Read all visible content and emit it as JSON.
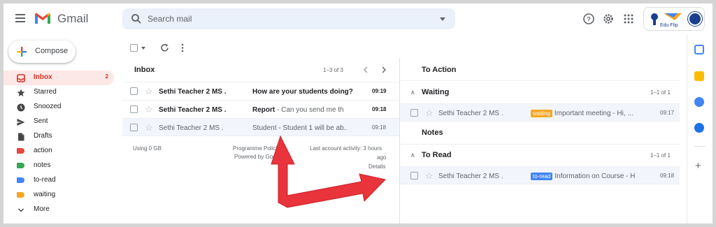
{
  "header": {
    "app_name": "Gmail",
    "search_placeholder": "Search mail",
    "edu_logo_text": "Edu Flip",
    "icons": [
      "menu-icon",
      "help-icon",
      "settings-icon",
      "apps-icon"
    ]
  },
  "compose_label": "Compose",
  "sidebar": {
    "items": [
      {
        "label": "Inbox",
        "count": "2",
        "icon": "inbox-icon",
        "active": true
      },
      {
        "label": "Starred",
        "icon": "star-icon"
      },
      {
        "label": "Snoozed",
        "icon": "clock-icon"
      },
      {
        "label": "Sent",
        "icon": "send-icon"
      },
      {
        "label": "Drafts",
        "icon": "draft-icon"
      },
      {
        "label": "action",
        "icon": "label-icon",
        "color": "#e8453c"
      },
      {
        "label": "notes",
        "icon": "label-icon",
        "color": "#34a853"
      },
      {
        "label": "to-read",
        "icon": "label-icon",
        "color": "#4285f4"
      },
      {
        "label": "waiting",
        "icon": "label-icon",
        "color": "#f6a623"
      },
      {
        "label": "More",
        "icon": "chevron-down-icon"
      }
    ]
  },
  "inbox": {
    "title": "Inbox",
    "pager": "1–3 of 3",
    "rows": [
      {
        "sender": "Sethi Teacher 2 MS .",
        "subject": "How are your students doing?",
        "snippet": "",
        "time": "09:19",
        "unread": true
      },
      {
        "sender": "Sethi Teacher 2 MS .",
        "subject": "Report",
        "snippet": " - Can you send me th...",
        "time": "09:18",
        "unread": true
      },
      {
        "sender": "Sethi Teacher 2 MS .",
        "subject": "Student",
        "snippet": " - Student 1 will be ab...",
        "time": "09:18",
        "unread": false
      }
    ],
    "footer": {
      "storage": "Using 0 GB",
      "policies": "Programme Policies",
      "powered": "Powered by Google",
      "activity_1": "Last account activity: 3 hours",
      "activity_2": "ago",
      "details": "Details"
    }
  },
  "right_pane": {
    "to_action": "To Action",
    "waiting": {
      "title": "Waiting",
      "pager": "1–1 of 1",
      "row": {
        "sender": "Sethi Teacher 2 MS .",
        "badge": "waiting",
        "badge_color": "#f6a623",
        "subject": "Important meeting - Hi, ...",
        "time": "09:17"
      }
    },
    "notes": "Notes",
    "to_read": {
      "title": "To Read",
      "pager": "1–1 of 1",
      "row": {
        "sender": "Sethi Teacher 2 MS .",
        "badge": "to-read",
        "badge_color": "#4285f4",
        "subject": "Information on Course - H",
        "time": "09:18"
      }
    }
  },
  "colors": {
    "accent_red": "#d93025",
    "arrow": "#e8343a"
  }
}
